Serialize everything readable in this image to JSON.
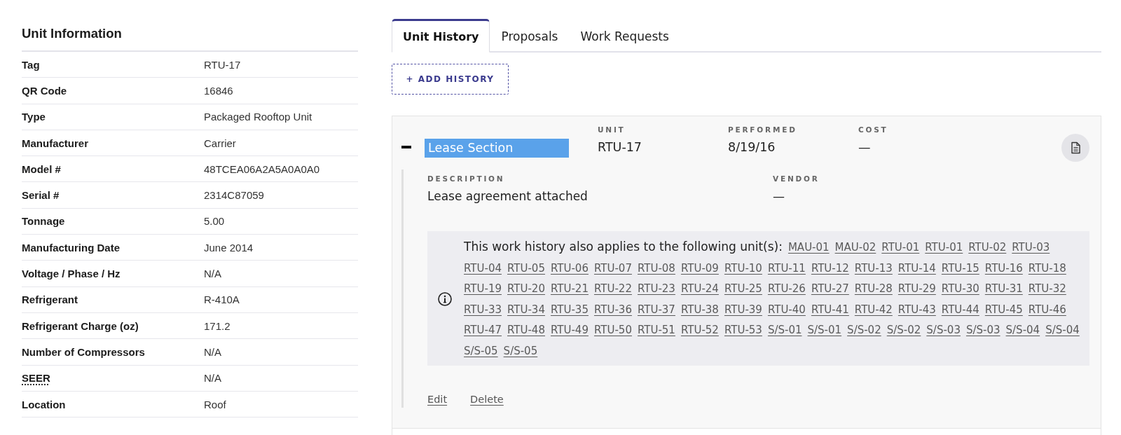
{
  "unit_information": {
    "title": "Unit Information",
    "rows": [
      {
        "label": "Tag",
        "value": "RTU-17",
        "abbreviation": false
      },
      {
        "label": "QR Code",
        "value": "16846",
        "abbreviation": false
      },
      {
        "label": "Type",
        "value": "Packaged Rooftop Unit",
        "abbreviation": false
      },
      {
        "label": "Manufacturer",
        "value": "Carrier",
        "abbreviation": false
      },
      {
        "label": "Model #",
        "value": "48TCEA06A2A5A0A0A0",
        "abbreviation": false
      },
      {
        "label": "Serial #",
        "value": "2314C87059",
        "abbreviation": false
      },
      {
        "label": "Tonnage",
        "value": "5.00",
        "abbreviation": false
      },
      {
        "label": "Manufacturing Date",
        "value": "June 2014",
        "abbreviation": false
      },
      {
        "label": "Voltage / Phase / Hz",
        "value": "N/A",
        "abbreviation": false
      },
      {
        "label": "Refrigerant",
        "value": "R-410A",
        "abbreviation": false
      },
      {
        "label": "Refrigerant Charge (oz)",
        "value": "171.2",
        "abbreviation": false
      },
      {
        "label": "Number of Compressors",
        "value": "N/A",
        "abbreviation": false
      },
      {
        "label": "SEER",
        "value": "N/A",
        "abbreviation": true
      },
      {
        "label": "Location",
        "value": "Roof",
        "abbreviation": false
      }
    ]
  },
  "tabs": [
    {
      "label": "Unit History",
      "selected": true
    },
    {
      "label": "Proposals",
      "selected": false
    },
    {
      "label": "Work Requests",
      "selected": false
    }
  ],
  "add_button": {
    "label": "+ ADD HISTORY"
  },
  "history_entry": {
    "expanded": true,
    "title": {
      "value": "Lease Section",
      "highlighted": true
    },
    "fields": [
      {
        "label": "UNIT",
        "value": "RTU-17"
      },
      {
        "label": "PERFORMED",
        "value": "8/19/16"
      },
      {
        "label": "COST",
        "value": "—"
      }
    ],
    "details": [
      {
        "label": "DESCRIPTION",
        "value": "Lease agreement attached"
      },
      {
        "label": "VENDOR",
        "value": "—"
      }
    ],
    "applies_notice": {
      "text": "This work history also applies to the following unit(s):",
      "units": [
        "MAU-01",
        "MAU-02",
        "RTU-01",
        "RTU-01",
        "RTU-02",
        "RTU-03",
        "RTU-04",
        "RTU-05",
        "RTU-06",
        "RTU-07",
        "RTU-08",
        "RTU-09",
        "RTU-10",
        "RTU-11",
        "RTU-12",
        "RTU-13",
        "RTU-14",
        "RTU-15",
        "RTU-16",
        "RTU-18",
        "RTU-19",
        "RTU-20",
        "RTU-21",
        "RTU-22",
        "RTU-23",
        "RTU-24",
        "RTU-25",
        "RTU-26",
        "RTU-27",
        "RTU-28",
        "RTU-29",
        "RTU-30",
        "RTU-31",
        "RTU-32",
        "RTU-33",
        "RTU-34",
        "RTU-35",
        "RTU-36",
        "RTU-37",
        "RTU-38",
        "RTU-39",
        "RTU-40",
        "RTU-41",
        "RTU-42",
        "RTU-43",
        "RTU-44",
        "RTU-45",
        "RTU-46",
        "RTU-47",
        "RTU-48",
        "RTU-49",
        "RTU-50",
        "RTU-51",
        "RTU-52",
        "RTU-53",
        "S/S-01",
        "S/S-01",
        "S/S-02",
        "S/S-02",
        "S/S-03",
        "S/S-03",
        "S/S-04",
        "S/S-04",
        "S/S-05",
        "S/S-05"
      ]
    },
    "actions": [
      "Edit",
      "Delete"
    ]
  }
}
